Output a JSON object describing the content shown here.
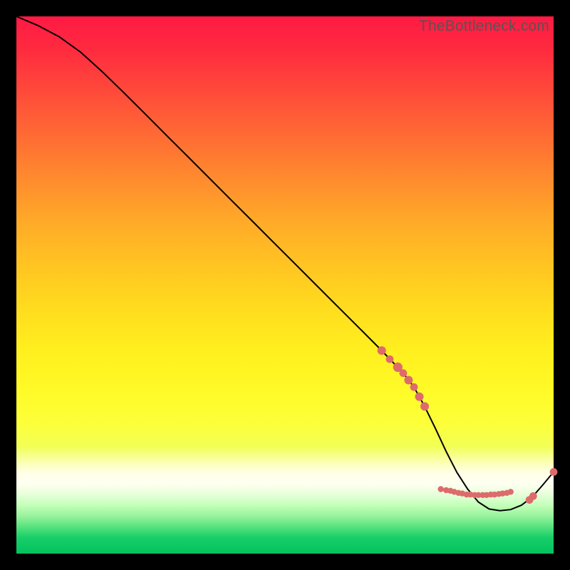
{
  "watermark": "TheBottleneck.com",
  "colors": {
    "marker": "#dd6b6b",
    "curve": "#000000",
    "frame_bg": "#000000"
  },
  "chart_data": {
    "type": "line",
    "title": "",
    "xlabel": "",
    "ylabel": "",
    "xlim": [
      0,
      100
    ],
    "ylim": [
      0,
      100
    ],
    "grid": false,
    "curve": {
      "x": [
        0,
        4,
        8,
        12,
        16,
        20,
        24,
        28,
        32,
        36,
        40,
        44,
        48,
        52,
        56,
        60,
        64,
        68,
        72,
        74,
        76,
        78,
        80,
        82,
        84,
        86,
        88,
        90,
        92,
        94,
        96,
        98,
        100
      ],
      "y": [
        100,
        98.3,
        96.2,
        93.3,
        89.7,
        85.8,
        81.8,
        77.8,
        73.8,
        69.8,
        65.8,
        61.8,
        57.8,
        53.8,
        49.8,
        45.8,
        41.8,
        37.8,
        33.6,
        31.0,
        27.4,
        23.3,
        19.0,
        15.1,
        12.0,
        9.6,
        8.3,
        8.0,
        8.2,
        9.0,
        10.5,
        12.8,
        15.2
      ]
    },
    "markers": [
      {
        "x": 68.0,
        "y": 37.8,
        "r": 1.0
      },
      {
        "x": 69.5,
        "y": 36.2,
        "r": 0.9
      },
      {
        "x": 71.0,
        "y": 34.7,
        "r": 1.1
      },
      {
        "x": 72.0,
        "y": 33.6,
        "r": 0.9
      },
      {
        "x": 73.0,
        "y": 32.3,
        "r": 1.0
      },
      {
        "x": 74.0,
        "y": 31.0,
        "r": 0.9
      },
      {
        "x": 75.0,
        "y": 29.2,
        "r": 1.0
      },
      {
        "x": 76.0,
        "y": 27.4,
        "r": 1.0
      },
      {
        "x": 79.0,
        "y": 12.0,
        "r": 0.7
      },
      {
        "x": 80.0,
        "y": 11.8,
        "r": 0.7
      },
      {
        "x": 80.8,
        "y": 11.7,
        "r": 0.7
      },
      {
        "x": 81.5,
        "y": 11.5,
        "r": 0.7
      },
      {
        "x": 82.3,
        "y": 11.3,
        "r": 0.7
      },
      {
        "x": 83.0,
        "y": 11.2,
        "r": 0.7
      },
      {
        "x": 83.8,
        "y": 11.0,
        "r": 0.7
      },
      {
        "x": 84.5,
        "y": 11.0,
        "r": 0.7
      },
      {
        "x": 85.3,
        "y": 10.9,
        "r": 0.7
      },
      {
        "x": 86.0,
        "y": 10.9,
        "r": 0.7
      },
      {
        "x": 86.8,
        "y": 10.9,
        "r": 0.7
      },
      {
        "x": 87.5,
        "y": 10.9,
        "r": 0.7
      },
      {
        "x": 88.3,
        "y": 11.0,
        "r": 0.7
      },
      {
        "x": 89.0,
        "y": 11.0,
        "r": 0.7
      },
      {
        "x": 89.8,
        "y": 11.1,
        "r": 0.7
      },
      {
        "x": 90.5,
        "y": 11.2,
        "r": 0.7
      },
      {
        "x": 91.3,
        "y": 11.3,
        "r": 0.7
      },
      {
        "x": 92.0,
        "y": 11.5,
        "r": 0.7
      },
      {
        "x": 95.5,
        "y": 10.0,
        "r": 0.9
      },
      {
        "x": 96.2,
        "y": 10.7,
        "r": 0.9
      },
      {
        "x": 100.0,
        "y": 15.2,
        "r": 0.9
      }
    ]
  }
}
